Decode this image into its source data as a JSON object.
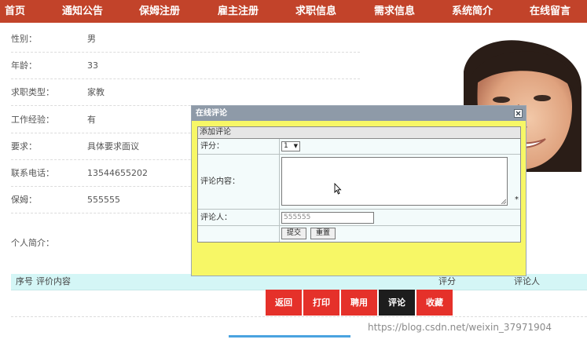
{
  "nav": {
    "items": [
      "首页",
      "通知公告",
      "保姆注册",
      "雇主注册",
      "求职信息",
      "需求信息",
      "系统简介",
      "在线留言"
    ]
  },
  "profile": {
    "gender_label": "性别：",
    "gender_value": "男",
    "age_label": "年龄：",
    "age_value": "33",
    "job_type_label": "求职类型：",
    "job_type_value": "家教",
    "experience_label": "工作经验：",
    "experience_value": "有",
    "requirement_label": "要求：",
    "requirement_value": "具体要求面议",
    "phone_label": "联系电话：",
    "phone_value": "13544655202",
    "nanny_label": "保姆：",
    "nanny_value": "555555",
    "intro_label": "个人简介："
  },
  "table": {
    "col_index": "序号",
    "col_content": "评价内容",
    "col_score": "评分",
    "col_reviewer": "评论人"
  },
  "actions": {
    "back": "返回",
    "print": "打印",
    "hire": "聘用",
    "comment": "评论",
    "favorite": "收藏"
  },
  "modal": {
    "title": "在线评论",
    "caption": "添加评论",
    "score_label": "评分：",
    "score_value": "1",
    "content_label": "评论内容：",
    "required_mark": "*",
    "reviewer_label": "评论人：",
    "reviewer_value": "555555",
    "submit_label": "提交",
    "reset_label": "重置"
  },
  "watermark": "https://blog.csdn.net/weixin_37971904",
  "colors": {
    "nav_bg": "#c2432a",
    "action_red": "#e5312a",
    "action_dark": "#1d1d1d",
    "modal_bg": "#f7f766",
    "modal_title_bg": "#8e9aa8",
    "table_header_bg": "#d4f6f6"
  }
}
